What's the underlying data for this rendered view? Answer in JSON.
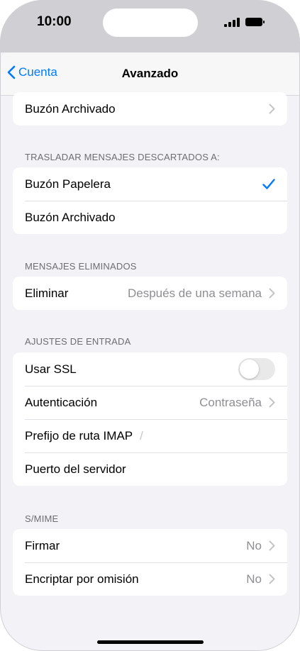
{
  "status": {
    "time": "10:00"
  },
  "nav": {
    "back_label": "Cuenta",
    "title": "Avanzado"
  },
  "top_item": {
    "label": "Buzón Archivado"
  },
  "move_discarded": {
    "header": "TRASLADAR MENSAJES DESCARTADOS A:",
    "options": [
      "Buzón Papelera",
      "Buzón Archivado"
    ],
    "selected": "Buzón Papelera"
  },
  "deleted": {
    "header": "MENSAJES ELIMINADOS",
    "label": "Eliminar",
    "value": "Después de una semana"
  },
  "incoming": {
    "header": "AJUSTES DE ENTRADA",
    "ssl_label": "Usar SSL",
    "ssl_on": false,
    "auth_label": "Autenticación",
    "auth_value": "Contraseña",
    "imap_prefix_label": "Prefijo de ruta IMAP",
    "imap_prefix_value": "/",
    "server_port_label": "Puerto del servidor"
  },
  "smime": {
    "header": "S/MIME",
    "sign_label": "Firmar",
    "sign_value": "No",
    "encrypt_label": "Encriptar por omisión",
    "encrypt_value": "No"
  },
  "colors": {
    "accent": "#007aff",
    "background": "#f2f2f7",
    "secondary_text": "#8e8e93"
  }
}
